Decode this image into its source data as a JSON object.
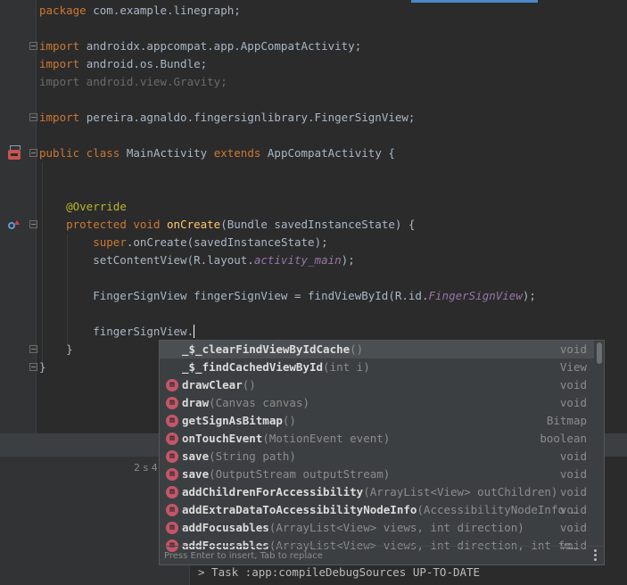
{
  "editor": {
    "lines": [
      {
        "text": "package com.example.linegraph;"
      },
      {
        "text": ""
      },
      {
        "text": "import androidx.appcompat.app.AppCompatActivity;"
      },
      {
        "text": "import android.os.Bundle;"
      },
      {
        "text": "import android.view.Gravity;"
      },
      {
        "text": ""
      },
      {
        "text": "import pereira.agnaldo.fingersignlibrary.FingerSignView;"
      },
      {
        "text": ""
      },
      {
        "text": "public class MainActivity extends AppCompatActivity {"
      },
      {
        "text": ""
      },
      {
        "text": ""
      },
      {
        "text": "    @Override"
      },
      {
        "text": "    protected void onCreate(Bundle savedInstanceState) {"
      },
      {
        "text": "        super.onCreate(savedInstanceState);"
      },
      {
        "text": "        setContentView(R.layout.activity_main);"
      },
      {
        "text": ""
      },
      {
        "text": "        FingerSignView fingerSignView = findViewById(R.id.FingerSignView);"
      },
      {
        "text": ""
      },
      {
        "text": "        fingerSignView."
      },
      {
        "text": "    }"
      },
      {
        "text": "}"
      }
    ],
    "gutter_icons": [
      "implemented-class-icon",
      "override-method-icon"
    ]
  },
  "completion_popup": {
    "items": [
      {
        "badge": "",
        "name": "_$_clearFindViewByIdCache",
        "params": "()",
        "type": "void",
        "selected": true
      },
      {
        "badge": "",
        "name": "_$_findCachedViewById",
        "params": "(int i)",
        "type": "View",
        "selected": false
      },
      {
        "badge": "m",
        "name": "drawClear",
        "params": "()",
        "type": "void",
        "selected": false
      },
      {
        "badge": "m",
        "name": "draw",
        "params": "(Canvas canvas)",
        "type": "void",
        "selected": false
      },
      {
        "badge": "m",
        "name": "getSignAsBitmap",
        "params": "()",
        "type": "Bitmap",
        "selected": false
      },
      {
        "badge": "m",
        "name": "onTouchEvent",
        "params": "(MotionEvent event)",
        "type": "boolean",
        "selected": false
      },
      {
        "badge": "m",
        "name": "save",
        "params": "(String path)",
        "type": "void",
        "selected": false
      },
      {
        "badge": "m",
        "name": "save",
        "params": "(OutputStream outputStream)",
        "type": "void",
        "selected": false
      },
      {
        "badge": "m",
        "name": "addChildrenForAccessibility",
        "params": "(ArrayList<View> outChildren)",
        "type": "void",
        "selected": false
      },
      {
        "badge": "m",
        "name": "addExtraDataToAccessibilityNodeInfo",
        "params": "(AccessibilityNodeInfo …",
        "type": "void",
        "selected": false
      },
      {
        "badge": "m",
        "name": "addFocusables",
        "params": "(ArrayList<View> views, int direction)",
        "type": "void",
        "selected": false
      },
      {
        "badge": "m",
        "name": "addFocusables",
        "params": "(ArrayList<View> views, int direction, int fo…",
        "type": "void",
        "selected": false
      }
    ],
    "footer_hint": "Press Enter to insert, Tab to replace"
  },
  "build_panel": {
    "timing": "2 s 4",
    "task_line": "> Task :app:compileDebugSources UP-TO-DATE"
  },
  "colors": {
    "background": "#2b2b2b",
    "keyword": "#cc7832",
    "annotation": "#bbb529",
    "method": "#ffc66d",
    "field": "#9876aa",
    "method_badge": "#c45669"
  }
}
